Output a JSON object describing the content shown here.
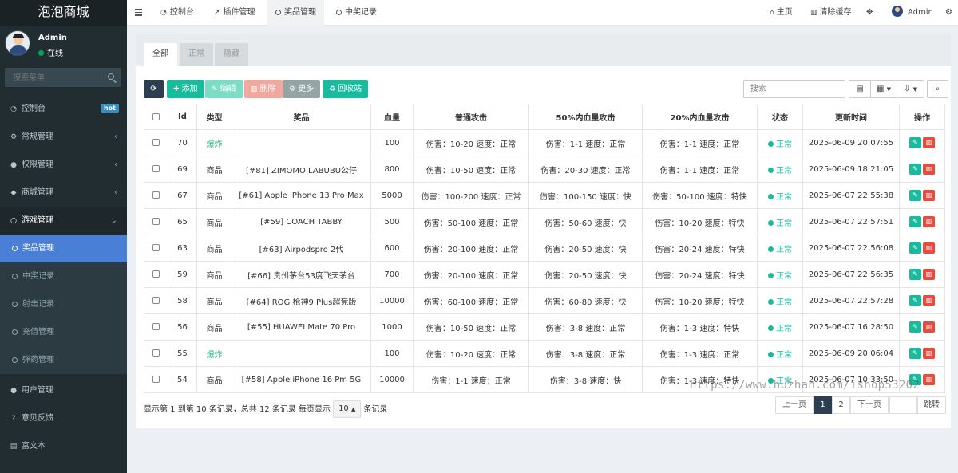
{
  "app": {
    "logo": "泡泡商城"
  },
  "user": {
    "name": "Admin",
    "status": "在线"
  },
  "sidebar": {
    "search_placeholder": "搜索菜单",
    "menu": [
      {
        "label": "控制台",
        "icon": "dashboard-icon",
        "badge": "hot"
      },
      {
        "label": "常规管理",
        "icon": "cogs-icon"
      },
      {
        "label": "权限管理",
        "icon": "group-icon"
      },
      {
        "label": "商城管理",
        "icon": "dropbox-icon"
      },
      {
        "label": "游戏管理",
        "icon": "circle-icon"
      }
    ],
    "submenu": [
      "奖品管理",
      "中奖记录",
      "射击记录",
      "充值管理",
      "弹药管理"
    ],
    "menu_bottom": [
      {
        "label": "用户管理",
        "icon": "user-icon"
      },
      {
        "label": "意见反馈",
        "icon": "question-icon"
      },
      {
        "label": "富文本",
        "icon": "file-icon"
      }
    ]
  },
  "header": {
    "tabs": [
      "控制台",
      "插件管理",
      "奖品管理",
      "中奖记录"
    ],
    "home": "主页",
    "clear_cache": "清除缓存",
    "admin": "Admin"
  },
  "filter_tabs": [
    "全部",
    "正常",
    "隐藏"
  ],
  "toolbar": {
    "add": "添加",
    "edit": "编辑",
    "delete": "删除",
    "more": "更多",
    "recycle": "回收站",
    "search_placeholder": "搜索"
  },
  "table": {
    "headers": [
      "Id",
      "类型",
      "奖品",
      "血量",
      "普通攻击",
      "50%内血量攻击",
      "20%内血量攻击",
      "状态",
      "更新时间",
      "操作"
    ],
    "rows": [
      {
        "id": "70",
        "type": "爆炸",
        "special": true,
        "prize": "",
        "hp": "100",
        "atk": "伤害：10-20 速度：正常",
        "atk50": "伤害：1-1 速度：正常",
        "atk20": "伤害：1-1 速度：正常",
        "status": "正常",
        "time": "2025-06-09 20:07:55"
      },
      {
        "id": "69",
        "type": "商品",
        "special": false,
        "prize": "[#81] ZIMOMO LABUBU公仔",
        "hp": "800",
        "atk": "伤害：10-50 速度：正常",
        "atk50": "伤害：20-30 速度：正常",
        "atk20": "伤害：1-1 速度：正常",
        "status": "正常",
        "time": "2025-06-09 18:21:05"
      },
      {
        "id": "67",
        "type": "商品",
        "special": false,
        "prize": "[#61] Apple iPhone 13 Pro Max",
        "hp": "5000",
        "atk": "伤害：100-200 速度：正常",
        "atk50": "伤害：100-150 速度：快",
        "atk20": "伤害：50-100 速度：特快",
        "status": "正常",
        "time": "2025-06-07 22:55:38"
      },
      {
        "id": "65",
        "type": "商品",
        "special": false,
        "prize": "[#59] COACH TABBY",
        "hp": "500",
        "atk": "伤害：50-100 速度：正常",
        "atk50": "伤害：50-60 速度：快",
        "atk20": "伤害：10-20 速度：特快",
        "status": "正常",
        "time": "2025-06-07 22:57:51"
      },
      {
        "id": "63",
        "type": "商品",
        "special": false,
        "prize": "[#63] Airpodspro 2代",
        "hp": "600",
        "atk": "伤害：20-100 速度：正常",
        "atk50": "伤害：20-50 速度：快",
        "atk20": "伤害：20-24 速度：特快",
        "status": "正常",
        "time": "2025-06-07 22:56:08"
      },
      {
        "id": "59",
        "type": "商品",
        "special": false,
        "prize": "[#66] 贵州茅台53度飞天茅台",
        "hp": "700",
        "atk": "伤害：20-100 速度：正常",
        "atk50": "伤害：20-50 速度：快",
        "atk20": "伤害：20-24 速度：特快",
        "status": "正常",
        "time": "2025-06-07 22:56:35"
      },
      {
        "id": "58",
        "type": "商品",
        "special": false,
        "prize": "[#64] ROG 枪神9 Plus超竞版",
        "hp": "10000",
        "atk": "伤害：60-100 速度：正常",
        "atk50": "伤害：60-80 速度：快",
        "atk20": "伤害：10-20 速度：特快",
        "status": "正常",
        "time": "2025-06-07 22:57:28"
      },
      {
        "id": "56",
        "type": "商品",
        "special": false,
        "prize": "[#55] HUAWEI Mate 70 Pro",
        "hp": "1000",
        "atk": "伤害：10-50 速度：正常",
        "atk50": "伤害：3-8 速度：正常",
        "atk20": "伤害：1-3 速度：特快",
        "status": "正常",
        "time": "2025-06-07 16:28:50"
      },
      {
        "id": "55",
        "type": "爆炸",
        "special": true,
        "prize": "",
        "hp": "100",
        "atk": "伤害：10-20 速度：正常",
        "atk50": "伤害：3-8 速度：正常",
        "atk20": "伤害：1-3 速度：正常",
        "status": "正常",
        "time": "2025-06-09 20:06:04"
      },
      {
        "id": "54",
        "type": "商品",
        "special": false,
        "prize": "[#58] Apple iPhone 16 Pm 5G",
        "hp": "10000",
        "atk": "伤害：1-1 速度：正常",
        "atk50": "伤害：3-8 速度：快",
        "atk20": "伤害：1-3 速度：特快",
        "status": "正常",
        "time": "2025-06-07 10:33:50"
      }
    ]
  },
  "pagination": {
    "info_prefix": "显示第 1 到第 10 条记录，总共 12 条记录 每页显示",
    "page_size": "10",
    "info_suffix": "条记录",
    "prev": "上一页",
    "pages": [
      "1",
      "2"
    ],
    "next": "下一页",
    "jump": "跳转"
  },
  "watermark": "https://www.huzhan.com/ishop53202",
  "colors": {
    "sidebar_bg": "#222d32",
    "active_menu": "#4a7fd6",
    "btn_refresh": "#2c3e50",
    "btn_add": "#18bc9c",
    "btn_edit": "#7ddcc6",
    "btn_delete": "#f1a89f",
    "btn_more": "#95a5a6",
    "btn_recycle": "#18bc9c"
  }
}
